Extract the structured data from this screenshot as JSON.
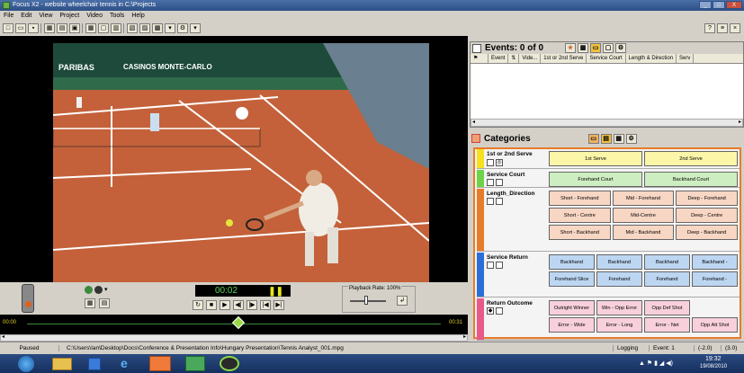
{
  "window": {
    "title": "Focus X2 - website wheelchair tennis in C:\\Projects",
    "controls": [
      "_",
      "□",
      "X"
    ]
  },
  "menu": [
    "File",
    "Edit",
    "View",
    "Project",
    "Video",
    "Tools",
    "Help"
  ],
  "video": {
    "scoreboard_left": "PARIBAS",
    "scoreboard_right": "CASINOS MONTE-CARLO",
    "time": "00:02",
    "playback_rate": "Playback Rate: 100%",
    "timeline_start": "00:00",
    "timeline_end": "00:31"
  },
  "events": {
    "title": "Events: 0 of 0",
    "columns": [
      "Event",
      "Vide...",
      "1st or 2nd Serve",
      "Service Court",
      "Length & Direction",
      "Serv"
    ]
  },
  "categories": {
    "title": "Categories",
    "rows": [
      {
        "label": "1st or 2nd Serve",
        "color": "#f5e11e",
        "buttons": [
          "1st Serve",
          "2nd Serve"
        ],
        "btn_color": "#fbf6a8"
      },
      {
        "label": "Service Court",
        "color": "#6fd34a",
        "buttons": [
          "Forehand Court",
          "Backhand Court"
        ],
        "btn_color": "#cdeec0"
      },
      {
        "label": "Length_Direction",
        "color": "#e87b2a",
        "buttons": [
          "Short - Forehand",
          "Mid - Forehand",
          "Deep - Forehand",
          "Short - Centre",
          "Mid-Centre",
          "Deep - Centre",
          "Short - Backhand",
          "Mid - Backhand",
          "Deep - Backhand"
        ],
        "btn_color": "#f8d6c4"
      },
      {
        "label": "Service Return",
        "color": "#2a6fd8",
        "buttons": [
          "Backhand",
          "Backhand",
          "Backhand",
          "Backhand -",
          "Forehand Slice",
          "Forehand",
          "Forehand",
          "Forehand -"
        ],
        "btn_color": "#bcd6f2"
      },
      {
        "label": "Return Outcome",
        "color": "#e85a8a",
        "buttons": [
          "Outright Winner",
          "Win - Opp Error",
          "Opp Def Shot",
          "",
          "Error - Wide",
          "Error - Long",
          "Error - Net",
          "Opp Att Shot"
        ],
        "btn_color": "#f8d0dc"
      }
    ]
  },
  "status": {
    "state": "Paused",
    "path": "C:\\Users\\Ian\\Desktop\\Docs\\Conference & Presentation Info\\Hungary Presentation\\Tennis Analyst_001.mpg",
    "mode": "Logging",
    "event": "Event: 1",
    "pos1": "(-2.0)",
    "pos2": "(3.0)"
  },
  "taskbar": {
    "clock_time": "19:32",
    "clock_date": "19/08/2010"
  }
}
